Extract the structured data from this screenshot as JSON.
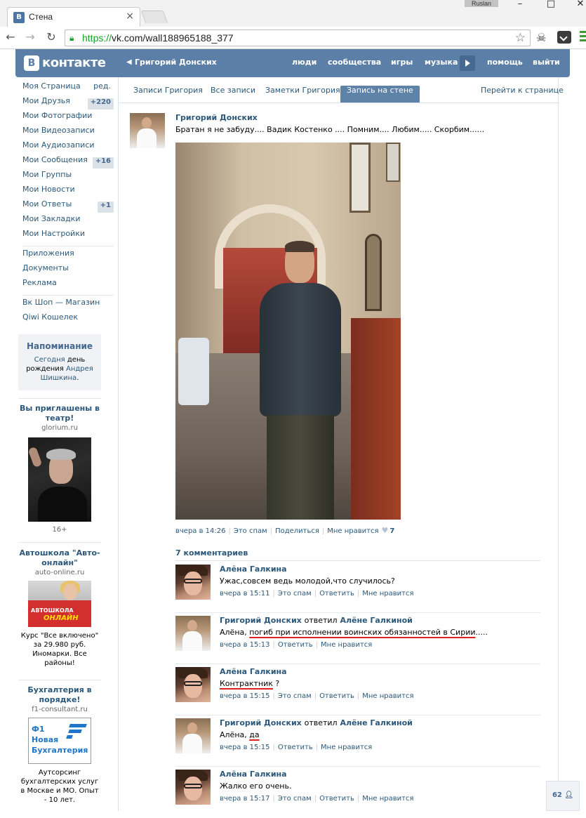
{
  "browser": {
    "tab_title": "Стена",
    "tab_favicon": "В",
    "tab_close": "×",
    "user_chip": "Ruslan",
    "url_scheme": "https://",
    "url_rest": "vk.com/wall188965188_377",
    "icons": [
      "back-icon",
      "forward-icon",
      "reload-icon",
      "lock-icon",
      "star-icon",
      "menu-icon"
    ]
  },
  "header": {
    "logo_letter": "В",
    "logo_text": "контакте",
    "back_name": "Григорий Донских",
    "nav": {
      "people": "люди",
      "communities": "сообщества",
      "games": "игры",
      "music": "музыка",
      "help": "помощь",
      "logout": "выйти"
    }
  },
  "sidebar": {
    "items": [
      {
        "label": "Моя Страница",
        "extra": "ред."
      },
      {
        "label": "Мои Друзья",
        "count": "+220"
      },
      {
        "label": "Мои Фотографии"
      },
      {
        "label": "Мои Видеозаписи"
      },
      {
        "label": "Мои Аудиозаписи"
      },
      {
        "label": "Мои Сообщения",
        "count": "+16"
      },
      {
        "label": "Мои Группы"
      },
      {
        "label": "Мои Новости"
      },
      {
        "label": "Мои Ответы",
        "count": "+1"
      },
      {
        "label": "Мои Закладки"
      },
      {
        "label": "Мои Настройки"
      }
    ],
    "items2": [
      {
        "label": "Приложения"
      },
      {
        "label": "Документы"
      },
      {
        "label": "Реклама"
      }
    ],
    "items3": [
      {
        "label": "Вк Шоп — Магазин"
      },
      {
        "label": "Qiwi Кошелек"
      }
    ]
  },
  "reminder": {
    "title": "Напоминание",
    "today": "Сегодня",
    "text1": " день рождения ",
    "name": "Андрея Шишкина",
    "end": "."
  },
  "ads": [
    {
      "title": "Вы приглашены в театр!",
      "domain": "glorium.ru",
      "age": "16+"
    },
    {
      "title": "Автошкола \"Авто-онлайн\"",
      "domain": "auto-online.ru",
      "img_text1": "АВТОШКОЛА",
      "img_text2": "ОНЛАЙН",
      "text": "Курс \"Все включено\" за 29.980 руб. Иномарки. Все районы!"
    },
    {
      "title": "Бухгалтерия в порядке!",
      "domain": "f1-consultant.ru",
      "img_text": "Ф1 Новая Бухгалтерия",
      "text": "Аутсорсинг бухгалтерских услуг в Москве и МО. Опыт - 10 лет."
    }
  ],
  "tabs": {
    "posts": "Записи Григория",
    "all": "Все записи",
    "notes": "Заметки Григория",
    "wallpost": "Запись на стене",
    "goto": "Перейти к странице"
  },
  "post": {
    "author": "Григорий Донских",
    "text": "Братан я не забуду.... Вадик Костенко .... Помним.... Любим..... Скорбим......",
    "time": "вчера в 14:26",
    "spam": "Это спам",
    "share": "Поделиться",
    "like": "Мне нравится",
    "likes": "7"
  },
  "comments_title": "7 комментариев",
  "comments": [
    {
      "name": "Алёна Галкина",
      "text": "Ужас,совсем ведь молодой,что случилось?",
      "time": "вчера в 15:11",
      "a1": "Это спам",
      "a2": "Ответить",
      "a3": "Мне нравится"
    },
    {
      "name": "Григорий Донских",
      "reply": "ответил",
      "reply_to": "Алёне Галкиной",
      "text_pre": "Алёна, ",
      "text_ul": "погиб при исполнении воинских обязанностей в Сирии",
      "text_post": ".....",
      "time": "вчера в 15:13",
      "a1": "Ответить",
      "a2": "Мне нравится"
    },
    {
      "name": "Алёна Галкина",
      "text_ul": "Контрактник",
      "text_post": " ?",
      "time": "вчера в 15:15",
      "a1": "Это спам",
      "a2": "Ответить",
      "a3": "Мне нравится"
    },
    {
      "name": "Григорий Донских",
      "reply": "ответил",
      "reply_to": "Алёне Галкиной",
      "text_pre": "Алёна, ",
      "text_ul": "да",
      "time": "вчера в 15:15",
      "a1": "Ответить",
      "a2": "Мне нравится"
    },
    {
      "name": "Алёна Галкина",
      "text": "Жалко его очень.",
      "time": "вчера в 15:17",
      "a1": "Это спам",
      "a2": "Ответить",
      "a3": "Мне нравится"
    }
  ],
  "online_count": "62"
}
